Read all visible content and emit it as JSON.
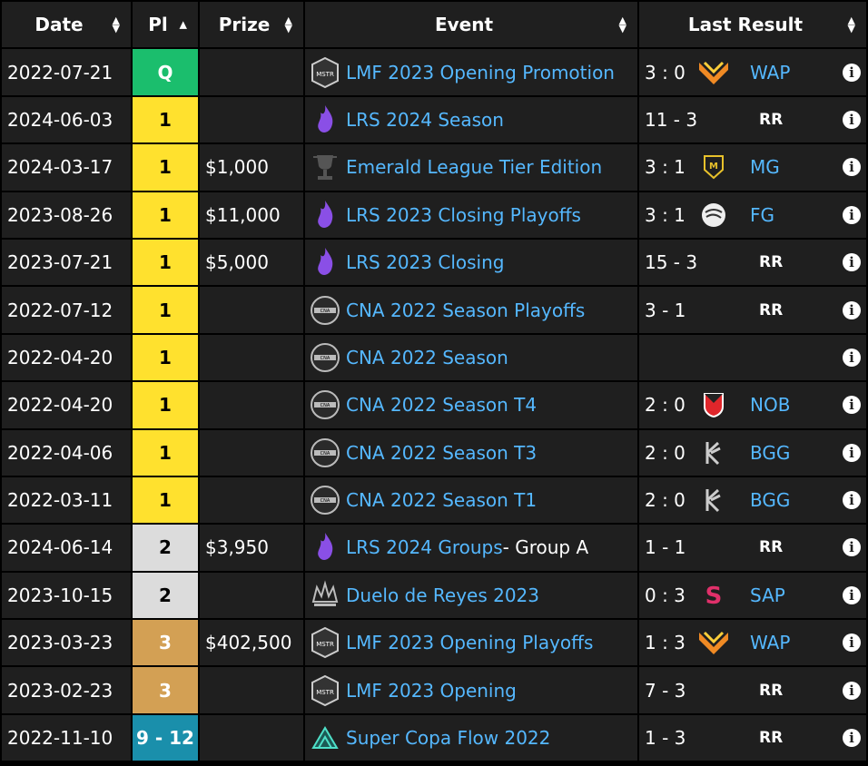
{
  "headers": {
    "date": "Date",
    "pl": "Pl",
    "prize": "Prize",
    "event": "Event",
    "result": "Last Result"
  },
  "colors": {
    "q": "#1bbe6d",
    "first": "#ffe12e",
    "second": "#dcdcdc",
    "third": "#d3a054",
    "range": "#1a8fab",
    "link": "#55b8ff"
  },
  "rows": [
    {
      "date": "2022-07-21",
      "pl": "Q",
      "pl_class": "q",
      "prize": "",
      "event": "LMF 2023 Opening Promotion",
      "event_suffix": "",
      "event_icon": "masters-icon",
      "score": "3 : 0",
      "team": "WAP",
      "team_icon": "wap-logo-icon",
      "rr": false
    },
    {
      "date": "2024-06-03",
      "pl": "1",
      "pl_class": "gold",
      "prize": "",
      "event": "LRS 2024 Season",
      "event_suffix": "",
      "event_icon": "lrs-icon",
      "score": "11 - 3",
      "team": "RR",
      "team_icon": "",
      "rr": true
    },
    {
      "date": "2024-03-17",
      "pl": "1",
      "pl_class": "gold",
      "prize": "$1,000",
      "event": "Emerald League Tier Edition",
      "event_suffix": "",
      "event_icon": "trophy-icon",
      "score": "3 : 1",
      "team": "MG",
      "team_icon": "mg-logo-icon",
      "rr": false
    },
    {
      "date": "2023-08-26",
      "pl": "1",
      "pl_class": "gold",
      "prize": "$11,000",
      "event": "LRS 2023 Closing Playoffs",
      "event_suffix": "",
      "event_icon": "lrs-icon",
      "score": "3 : 1",
      "team": "FG",
      "team_icon": "fg-logo-icon",
      "rr": false
    },
    {
      "date": "2023-07-21",
      "pl": "1",
      "pl_class": "gold",
      "prize": "$5,000",
      "event": "LRS 2023 Closing",
      "event_suffix": "",
      "event_icon": "lrs-icon",
      "score": "15 - 3",
      "team": "RR",
      "team_icon": "",
      "rr": true
    },
    {
      "date": "2022-07-12",
      "pl": "1",
      "pl_class": "gold",
      "prize": "",
      "event": "CNA 2022 Season Playoffs",
      "event_suffix": "",
      "event_icon": "cna-icon",
      "score": "3 - 1",
      "team": "RR",
      "team_icon": "",
      "rr": true
    },
    {
      "date": "2022-04-20",
      "pl": "1",
      "pl_class": "gold",
      "prize": "",
      "event": "CNA 2022 Season",
      "event_suffix": "",
      "event_icon": "cna-icon",
      "score": "",
      "team": "",
      "team_icon": "",
      "rr": false
    },
    {
      "date": "2022-04-20",
      "pl": "1",
      "pl_class": "gold",
      "prize": "",
      "event": "CNA 2022 Season T4",
      "event_suffix": "",
      "event_icon": "cna-icon",
      "score": "2 : 0",
      "team": "NOB",
      "team_icon": "nob-logo-icon",
      "rr": false
    },
    {
      "date": "2022-04-06",
      "pl": "1",
      "pl_class": "gold",
      "prize": "",
      "event": "CNA 2022 Season T3",
      "event_suffix": "",
      "event_icon": "cna-icon",
      "score": "2 : 0",
      "team": "BGG",
      "team_icon": "bgg-logo-icon",
      "rr": false
    },
    {
      "date": "2022-03-11",
      "pl": "1",
      "pl_class": "gold",
      "prize": "",
      "event": "CNA 2022 Season T1",
      "event_suffix": "",
      "event_icon": "cna-icon",
      "score": "2 : 0",
      "team": "BGG",
      "team_icon": "bgg-logo-icon",
      "rr": false
    },
    {
      "date": "2024-06-14",
      "pl": "2",
      "pl_class": "silver",
      "prize": "$3,950",
      "event": "LRS 2024 Groups",
      "event_suffix": " - Group A",
      "event_icon": "lrs-icon",
      "score": "1 - 1",
      "team": "RR",
      "team_icon": "",
      "rr": true
    },
    {
      "date": "2023-10-15",
      "pl": "2",
      "pl_class": "silver",
      "prize": "",
      "event": "Duelo de Reyes 2023",
      "event_suffix": "",
      "event_icon": "crown-icon",
      "score": "0 : 3",
      "team": "SAP",
      "team_icon": "sap-logo-icon",
      "rr": false
    },
    {
      "date": "2023-03-23",
      "pl": "3",
      "pl_class": "bronze",
      "prize": "$402,500",
      "event": "LMF 2023 Opening Playoffs",
      "event_suffix": "",
      "event_icon": "masters-icon",
      "score": "1 : 3",
      "team": "WAP",
      "team_icon": "wap-logo-icon",
      "rr": false
    },
    {
      "date": "2023-02-23",
      "pl": "3",
      "pl_class": "bronze",
      "prize": "",
      "event": "LMF 2023 Opening",
      "event_suffix": "",
      "event_icon": "masters-icon",
      "score": "7 - 3",
      "team": "RR",
      "team_icon": "",
      "rr": true
    },
    {
      "date": "2022-11-10",
      "pl": "9 - 12",
      "pl_class": "range",
      "prize": "",
      "event": "Super Copa Flow 2022",
      "event_suffix": "",
      "event_icon": "flow-icon",
      "score": "1 - 3",
      "team": "RR",
      "team_icon": "",
      "rr": true
    }
  ]
}
